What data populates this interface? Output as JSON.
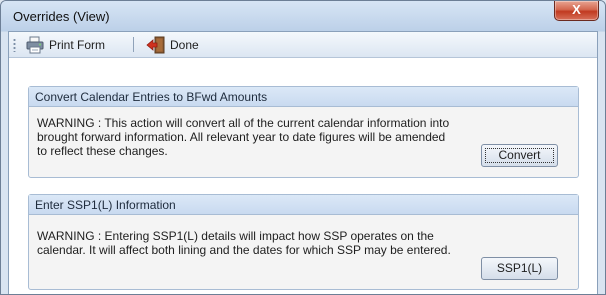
{
  "window": {
    "title": "Overrides (View)",
    "close_label": "X"
  },
  "toolbar": {
    "print_label": "Print Form",
    "done_label": "Done"
  },
  "panels": [
    {
      "header": "Convert Calendar Entries to BFwd Amounts",
      "warning": "WARNING : This action will convert all of the current calendar information into brought forward information. All relevant year to date figures will be amended to reflect these changes.",
      "button_label": "Convert"
    },
    {
      "header": "Enter SSP1(L) Information",
      "warning": "WARNING : Entering SSP1(L) details will impact how SSP operates on the calendar. It will affect both lining and the dates for which SSP may be entered.",
      "button_label": "SSP1(L)"
    }
  ]
}
